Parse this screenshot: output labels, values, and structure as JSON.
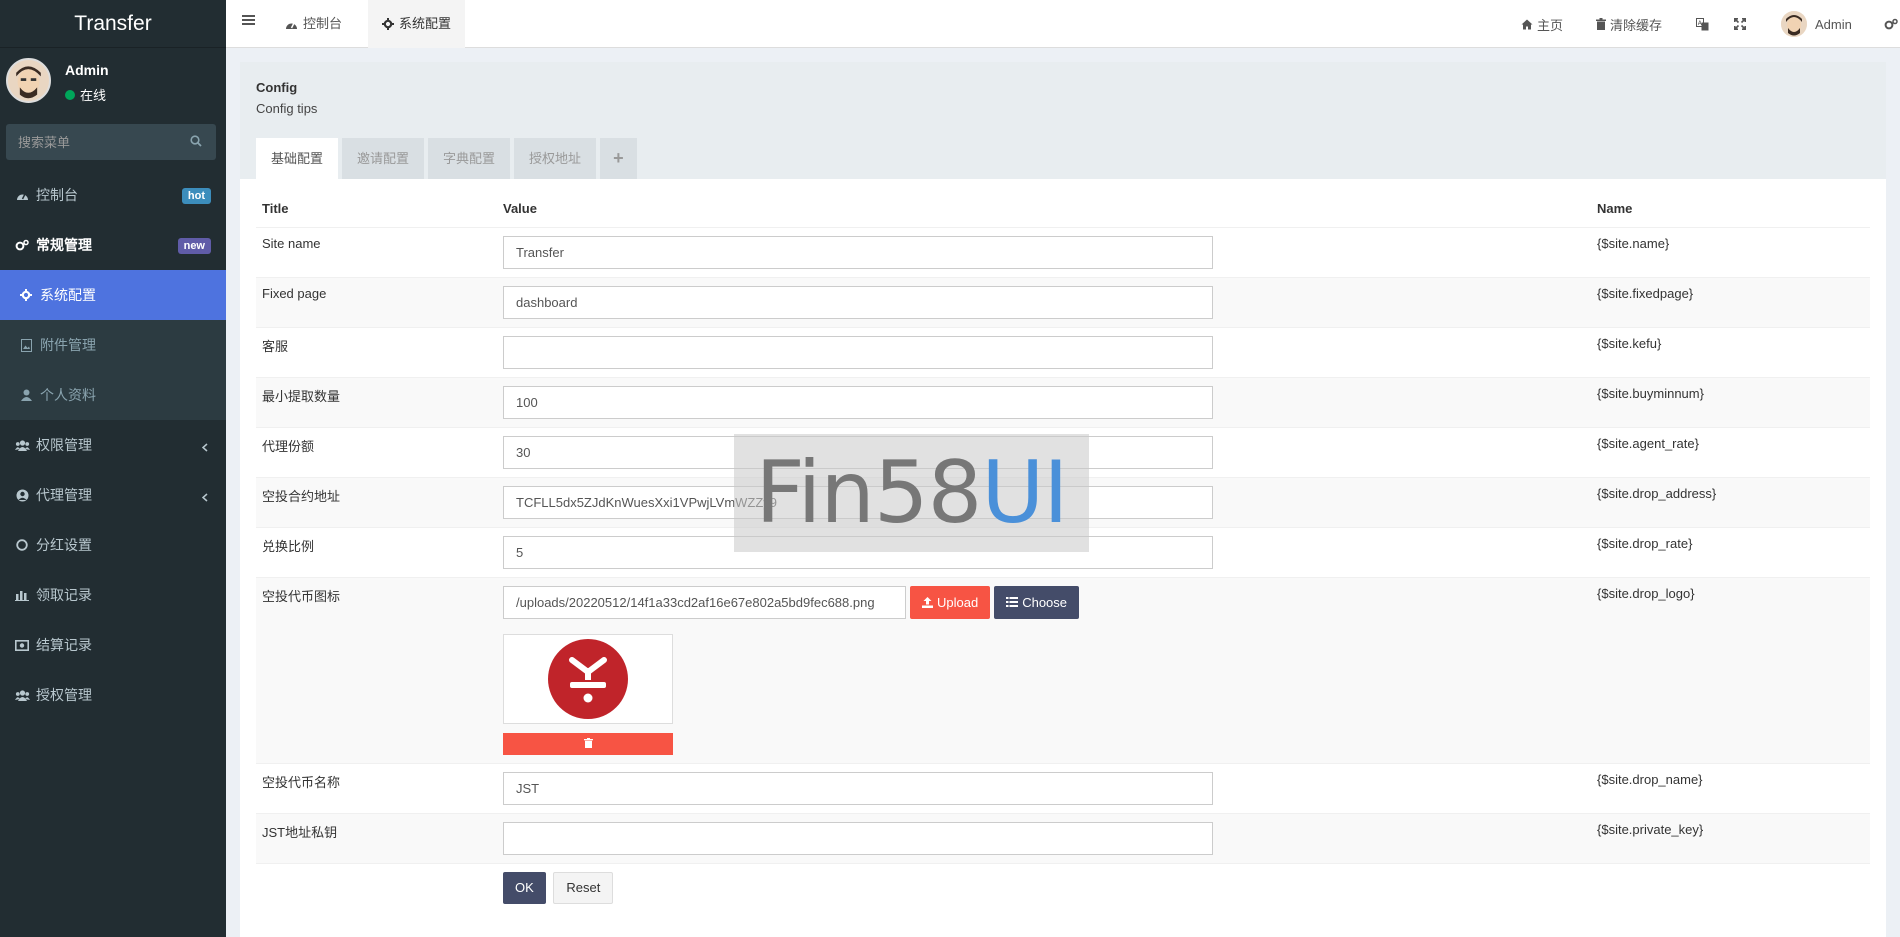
{
  "app": {
    "brand": "Transfer"
  },
  "user": {
    "name": "Admin",
    "status": "在线"
  },
  "sidebar": {
    "search_placeholder": "搜索菜单",
    "items": [
      {
        "label": "控制台",
        "badge": "hot"
      },
      {
        "label": "常规管理",
        "badge": "new"
      },
      {
        "label": "系统配置"
      },
      {
        "label": "附件管理"
      },
      {
        "label": "个人资料"
      },
      {
        "label": "权限管理"
      },
      {
        "label": "代理管理"
      },
      {
        "label": "分红设置"
      },
      {
        "label": "领取记录"
      },
      {
        "label": "结算记录"
      },
      {
        "label": "授权管理"
      }
    ]
  },
  "header": {
    "tabs": [
      {
        "label": "控制台"
      },
      {
        "label": "系统配置"
      }
    ],
    "home": "主页",
    "clear_cache": "清除缓存",
    "user": "Admin"
  },
  "panel": {
    "title": "Config",
    "tips": "Config tips",
    "tabs": [
      "基础配置",
      "邀请配置",
      "字典配置",
      "授权地址"
    ],
    "add_tab": "+"
  },
  "table": {
    "headers": {
      "title": "Title",
      "value": "Value",
      "name": "Name"
    },
    "rows": [
      {
        "title": "Site name",
        "value": "Transfer",
        "name": "{$site.name}"
      },
      {
        "title": "Fixed page",
        "value": "dashboard",
        "name": "{$site.fixedpage}"
      },
      {
        "title": "客服",
        "value": "",
        "name": "{$site.kefu}"
      },
      {
        "title": "最小提取数量",
        "value": "100",
        "name": "{$site.buyminnum}"
      },
      {
        "title": "代理份额",
        "value": "30",
        "name": "{$site.agent_rate}"
      },
      {
        "title": "空投合约地址",
        "value": "TCFLL5dx5ZJdKnWuesXxi1VPwjLVmWZZy9",
        "name": "{$site.drop_address}"
      },
      {
        "title": "兑换比例",
        "value": "5",
        "name": "{$site.drop_rate}"
      },
      {
        "title": "空投代币图标",
        "value": "/uploads/20220512/14f1a33cd2af16e67e802a5bd9fec688.png",
        "name": "{$site.drop_logo}"
      },
      {
        "title": "空投代币名称",
        "value": "JST",
        "name": "{$site.drop_name}"
      },
      {
        "title": "JST地址私钥",
        "value": "",
        "name": "{$site.private_key}"
      }
    ],
    "upload_label": "Upload",
    "choose_label": "Choose"
  },
  "buttons": {
    "ok": "OK",
    "reset": "Reset"
  },
  "watermark": {
    "part1": "Fin58",
    "part2": "UI"
  },
  "colors": {
    "sidebar_bg": "#222d32",
    "selected": "#4e73df",
    "danger": "#f75444",
    "navy": "#444c69"
  }
}
